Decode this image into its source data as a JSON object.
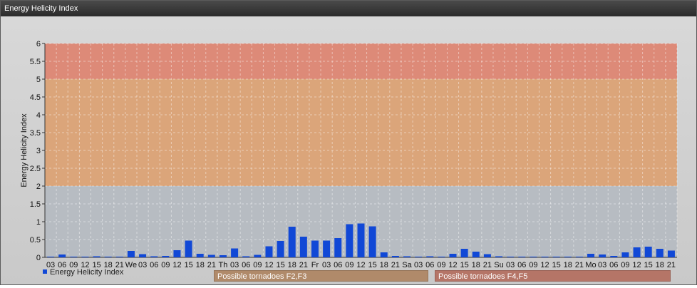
{
  "window": {
    "title": "Energy Helicity Index"
  },
  "legend": {
    "label": "Energy Helicity Index"
  },
  "bands": {
    "f23_label": "Possible tornadoes F2,F3",
    "f45_label": "Possible tornadoes F4,F5"
  },
  "colors": {
    "bar": "#1148d6",
    "zone_low": "#b7bcc2",
    "zone_mid": "#dba57a",
    "zone_high": "#dd8a78"
  },
  "chart_data": {
    "type": "bar",
    "title": "",
    "xlabel": "",
    "ylabel": "Energy Helicity Index",
    "ylim": [
      0,
      6
    ],
    "yticks": [
      "0",
      "0.5",
      "1",
      "1.5",
      "2",
      "2.5",
      "3",
      "3.5",
      "4",
      "4.5",
      "5",
      "5.5",
      "6"
    ],
    "grid": true,
    "legend_position": "bottom-left",
    "zones": [
      {
        "from": 0,
        "to": 2,
        "color": "#b7bcc2"
      },
      {
        "from": 2,
        "to": 5,
        "color": "#dba57a"
      },
      {
        "from": 5,
        "to": 6,
        "color": "#dd8a78"
      }
    ],
    "categories": [
      "03",
      "06",
      "09",
      "12",
      "15",
      "18",
      "21",
      "We",
      "03",
      "06",
      "09",
      "12",
      "15",
      "18",
      "21",
      "Th",
      "03",
      "06",
      "09",
      "12",
      "15",
      "18",
      "21",
      "Fr",
      "03",
      "06",
      "09",
      "12",
      "15",
      "18",
      "21",
      "Sa",
      "03",
      "06",
      "09",
      "12",
      "15",
      "18",
      "21",
      "Su",
      "03",
      "06",
      "09",
      "12",
      "15",
      "18",
      "21",
      "Mo",
      "03",
      "06",
      "09",
      "12",
      "15",
      "18",
      "21"
    ],
    "series": [
      {
        "name": "Energy Helicity Index",
        "values": [
          0.02,
          0.08,
          0.02,
          0.02,
          0.03,
          0.02,
          0.02,
          0.18,
          0.09,
          0.03,
          0.04,
          0.2,
          0.47,
          0.1,
          0.07,
          0.06,
          0.25,
          0.03,
          0.07,
          0.31,
          0.46,
          0.86,
          0.58,
          0.47,
          0.47,
          0.54,
          0.93,
          0.95,
          0.87,
          0.14,
          0.04,
          0.03,
          0.02,
          0.03,
          0.02,
          0.1,
          0.24,
          0.16,
          0.09,
          0.03,
          0.02,
          0.02,
          0.02,
          0.02,
          0.02,
          0.02,
          0.02,
          0.1,
          0.08,
          0.04,
          0.14,
          0.28,
          0.3,
          0.24,
          0.19
        ]
      }
    ]
  }
}
